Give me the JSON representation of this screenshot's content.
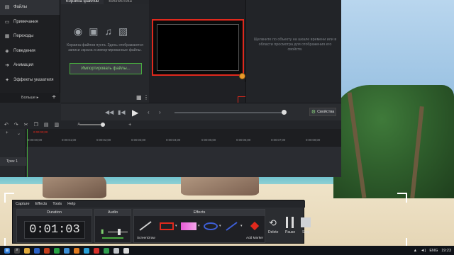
{
  "editor": {
    "sidebar": {
      "items": [
        {
          "icon": "files-icon",
          "label": "Файлы"
        },
        {
          "icon": "notes-icon",
          "label": "Примечания"
        },
        {
          "icon": "transitions-icon",
          "label": "Переходы"
        },
        {
          "icon": "behaviors-icon",
          "label": "Поведения"
        },
        {
          "icon": "animation-icon",
          "label": "Анимация"
        },
        {
          "icon": "cursor-effects-icon",
          "label": "Эффекты указателя"
        }
      ],
      "more_label": "Больше ▸",
      "add_label": "+"
    },
    "bin": {
      "tabs": [
        "Корзина файлов",
        "Библиотека"
      ],
      "empty_message": "Корзина файлов пуста. Здесь отображаются записи экрана и импортированные файлы.",
      "import_button": "Импортировать файлы..."
    },
    "properties_message": "Щелкните по объекту на шкале времени или в области просмотра для отображения его свойств.",
    "properties_button": "Свойства",
    "timeline": {
      "playhead_time": "0:00:00;00",
      "ruler_ticks": [
        "0:00:00;00",
        "0:00:01;00",
        "0:00:02;00",
        "0:00:03;00",
        "0:00:04;00",
        "0:00:05;00",
        "0:00:06;00",
        "0:00:07;00",
        "0:00:08;00"
      ],
      "track_label": "Трек 1"
    }
  },
  "recorder": {
    "menu": [
      "Capture",
      "Effects",
      "Tools",
      "Help"
    ],
    "duration_title": "Duration",
    "duration_value": "0:01:03",
    "audio_title": "Audio",
    "effects_title": "Effects",
    "screendraw_label": "ScreenDraw",
    "add_marker_label": "Add Marker",
    "delete_label": "Delete",
    "pause_label": "Pause",
    "stop_label": "Stop"
  },
  "taskbar": {
    "lang": "ENG",
    "time": "19:23"
  },
  "colors": {
    "accent_green": "#47ab3f",
    "highlight_red": "#e0291d",
    "cursor_orange": "#e89a2b"
  }
}
